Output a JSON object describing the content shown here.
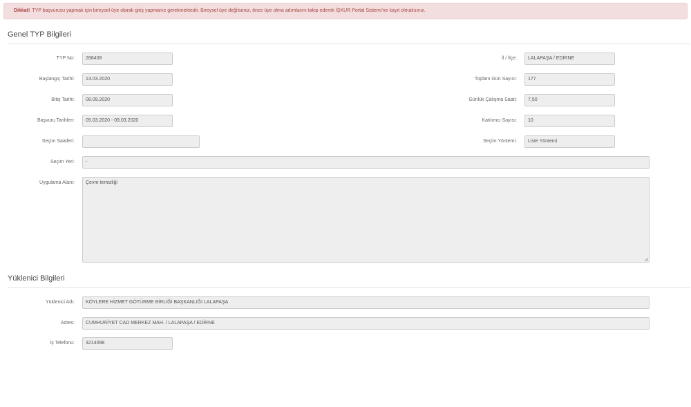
{
  "alert": {
    "strong": "Dikkat!",
    "text": "TYP başvurusu yapmak için bireysel üye olarak giriş yapmanız gerekmektedir. Bireysel üye değilseniz, önce üye olma adımlarını takip ederek İŞKUR Portal Sistemi'ne kayıt olmalısınız."
  },
  "genel": {
    "title": "Genel TYP Bilgileri",
    "typ_no": {
      "label": "TYP No:",
      "value": "268408"
    },
    "baslangic": {
      "label": "Başlangıç Tarihi:",
      "value": "13.03.2020"
    },
    "bitis": {
      "label": "Bitiş Tarihi:",
      "value": "08.09.2020"
    },
    "basvuru": {
      "label": "Başvuru Tarihleri:",
      "value": "05.03.2020 - 09.03.2020"
    },
    "secim_saatleri": {
      "label": "Seçim Saatleri:",
      "value": ""
    },
    "secim_yeri": {
      "label": "Seçim Yeri:",
      "value": "-"
    },
    "uygulama": {
      "label": "Uygulama Alanı:",
      "value": "Çevre temizliği"
    },
    "il_ilce": {
      "label": "İl / İlçe:",
      "value": "LALAPAŞA / EDİRNE"
    },
    "toplam_gun": {
      "label": "Toplam Gün Sayısı:",
      "value": "177"
    },
    "gunluk_saat": {
      "label": "Günlük Çalışma Saati:",
      "value": "7,50"
    },
    "katilimci": {
      "label": "Katılımcı Sayısı:",
      "value": "10"
    },
    "secim_yontemi": {
      "label": "Seçim Yöntemi:",
      "value": "Liste Yöntemi"
    }
  },
  "yuklenici": {
    "title": "Yüklenici Bilgileri",
    "adi": {
      "label": "Yüklenici Adı:",
      "value": "KÖYLERE HİZMET GÖTÜRME BİRLİĞİ BAŞKANLIĞI LALAPAŞA"
    },
    "adres": {
      "label": "Adres:",
      "value": "CUMHURİYET CAD MERKEZ MAH. / LALAPAŞA / EDİRNE"
    },
    "telefon": {
      "label": "İş Telefonu:",
      "value": "3214098"
    }
  }
}
